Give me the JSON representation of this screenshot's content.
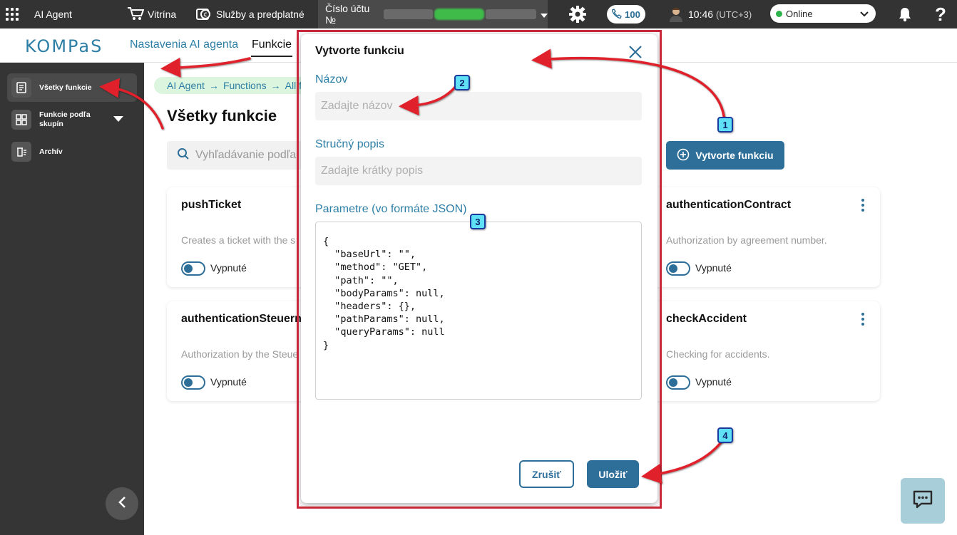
{
  "topbar": {
    "app_name": "AI Agent",
    "showcase": "Vitrína",
    "services": "Služby a predplatné",
    "account_prefix": "Číslo účtu №",
    "calls": "100",
    "time": "10:46",
    "timezone": "(UTC+3)",
    "status": "Online"
  },
  "header": {
    "logo": "KOMPaS",
    "nav_settings": "Nastavenia AI agenta",
    "nav_functions": "Funkcie"
  },
  "sidebar": {
    "items": [
      {
        "label": "Všetky funkcie"
      },
      {
        "label": "Funkcie podľa skupín"
      },
      {
        "label": "Archív"
      }
    ]
  },
  "main": {
    "breadcrumbs": [
      "AI Agent",
      "Functions",
      "All f"
    ],
    "title": "Všetky funkcie",
    "search_placeholder": "Vyhľadávanie podľa",
    "create_button": "Vytvorte funkciu",
    "cards": [
      {
        "title": "pushTicket",
        "description": "Creates a ticket with the s",
        "toggle_label": "Vypnuté"
      },
      {
        "title": "authenticationContract",
        "description": "Authorization by agreement number.",
        "toggle_label": "Vypnuté"
      },
      {
        "title": "authenticationSteuern",
        "description": "Authorization by the Steue",
        "toggle_label": "Vypnuté"
      },
      {
        "title": "checkAccident",
        "description": "Checking for accidents.",
        "toggle_label": "Vypnuté"
      }
    ]
  },
  "modal": {
    "title": "Vytvorte funkciu",
    "name_label": "Názov",
    "name_placeholder": "Zadajte názov",
    "desc_label": "Stručný popis",
    "desc_placeholder": "Zadajte krátky popis",
    "params_label": "Parametre (vo formáte JSON)",
    "params_value": "{\n  \"baseUrl\": \"\",\n  \"method\": \"GET\",\n  \"path\": \"\",\n  \"bodyParams\": null,\n  \"headers\": {},\n  \"pathParams\": null,\n  \"queryParams\": null\n}",
    "cancel": "Zrušiť",
    "save": "Uložiť"
  },
  "annotations": {
    "badges": [
      "1",
      "2",
      "3",
      "4"
    ]
  },
  "colors": {
    "accent": "#2e6f99",
    "annotation_arrow": "#e0202a",
    "modal_frame": "#c9283a",
    "online": "#2fb24c"
  }
}
